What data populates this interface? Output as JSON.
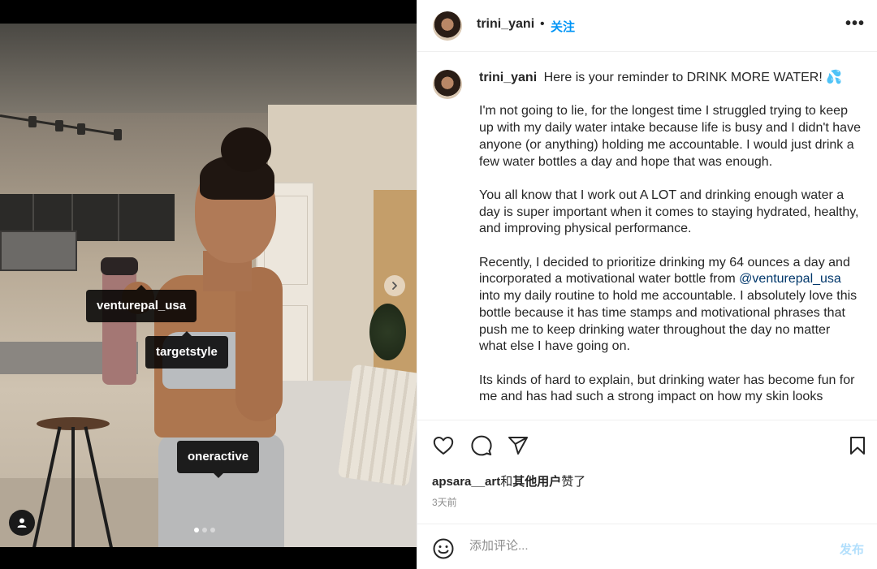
{
  "media": {
    "tags": [
      {
        "label": "venturepal_usa"
      },
      {
        "label": "targetstyle"
      },
      {
        "label": "oneractive"
      }
    ],
    "carousel_total": 3,
    "carousel_active": 1
  },
  "header": {
    "username": "trini_yani",
    "separator": "•",
    "follow_label": "关注",
    "more_icon": "more-options-icon"
  },
  "caption": {
    "username": "trini_yani",
    "paragraphs": [
      "Here is your reminder to DRINK MORE WATER! 💦",
      "I'm not going to lie, for the longest time I struggled trying to keep up with my daily water intake because life is busy and I didn't have anyone (or anything) holding me accountable. I would just drink a few water bottles a day and hope that was enough.",
      "You all know that I work out A LOT and drinking enough water a day is super important when it comes to staying hydrated, healthy, and improving physical performance.",
      "Recently, I decided to prioritize drinking my 64 ounces a day and incorporated a motivational water bottle from",
      "Its kinds of hard to explain, but drinking water has become fun for me and has had such a strong impact on how my skin looks"
    ],
    "mention": "@venturepal_usa",
    "after_mention": "into my daily routine to hold me accountable. I absolutely love this bottle because it has time stamps and motivational phrases that push me to keep drinking water throughout the day no matter what else I have going on."
  },
  "actions": {
    "likes_user": "apsara__art",
    "likes_connector": "和",
    "likes_others": "其他用户",
    "likes_suffix": "赞了",
    "time": "3天前"
  },
  "comment": {
    "placeholder": "添加评论...",
    "post_label": "发布"
  },
  "colors": {
    "accent": "#0095f6",
    "post_disabled": "#b2dffc",
    "mention": "#00376b",
    "muted": "#8e8e8e"
  }
}
